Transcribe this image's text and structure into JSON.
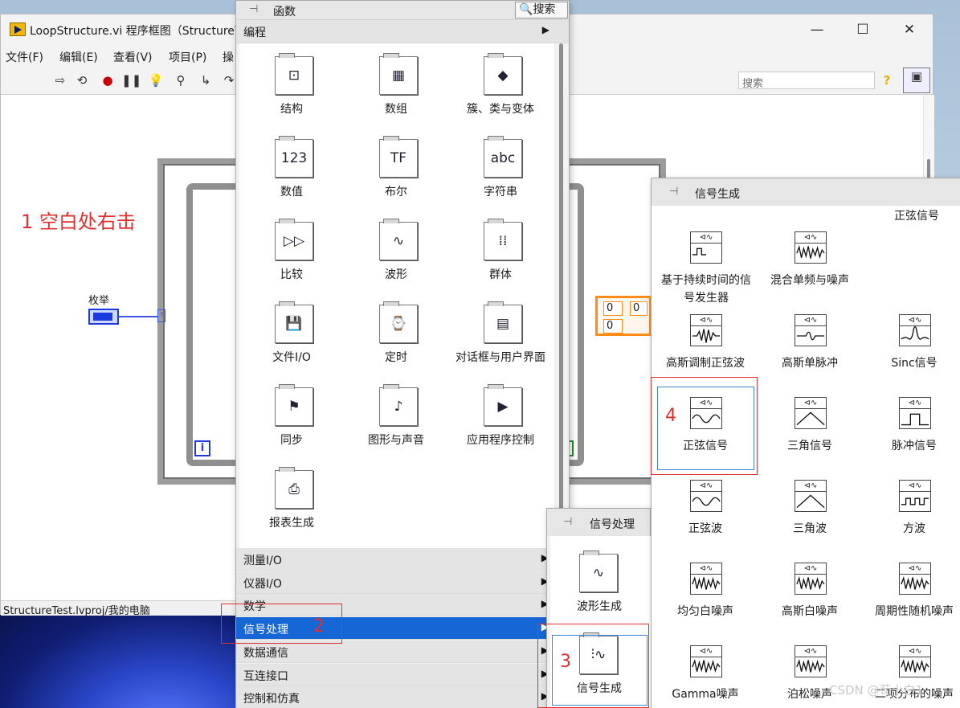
{
  "window": {
    "title": "LoopStructure.vi 程序框图（StructureTe",
    "minimize": "—",
    "maximize": "☐",
    "close": "✕"
  },
  "menu": [
    "文件(F)",
    "编辑(E)",
    "查看(V)",
    "项目(P)",
    "操"
  ],
  "toolbar": {
    "search_placeholder": "搜索",
    "tools": [
      "run-arrow-icon",
      "run-continuous-icon",
      "abort-icon",
      "pause-icon",
      "highlight-icon",
      "probe-icon",
      "step-into-icon",
      "step-over-icon"
    ]
  },
  "status": "StructureTest.lvproj/我的电脑",
  "diagram": {
    "annotation": "1 空白处右击",
    "enum_label": "枚举",
    "iteration": "i",
    "terminal": "?",
    "cluster_values": [
      "0",
      "0",
      "0"
    ]
  },
  "functions_palette": {
    "title": "函数",
    "search": "搜索",
    "section": "编程",
    "items": [
      {
        "label": "结构",
        "icon": "structure-icon",
        "glyph": "⊡"
      },
      {
        "label": "数组",
        "icon": "array-icon",
        "glyph": "▦"
      },
      {
        "label": "簇、类与变体",
        "icon": "cluster-class-icon",
        "glyph": "◆"
      },
      {
        "label": "数值",
        "icon": "numeric-icon",
        "glyph": "123"
      },
      {
        "label": "布尔",
        "icon": "boolean-icon",
        "glyph": "TF"
      },
      {
        "label": "字符串",
        "icon": "string-icon",
        "glyph": "abc"
      },
      {
        "label": "比较",
        "icon": "compare-icon",
        "glyph": "▷▷"
      },
      {
        "label": "波形",
        "icon": "waveform-icon",
        "glyph": "∿"
      },
      {
        "label": "群体",
        "icon": "synchronization-group-icon",
        "glyph": "⁞⁞"
      },
      {
        "label": "文件I/O",
        "icon": "file-io-icon",
        "glyph": "💾"
      },
      {
        "label": "定时",
        "icon": "timing-icon",
        "glyph": "⌚"
      },
      {
        "label": "对话框与用户界面",
        "icon": "dialog-ui-icon",
        "glyph": "▤"
      },
      {
        "label": "同步",
        "icon": "synchronization-icon",
        "glyph": "⚑"
      },
      {
        "label": "图形与声音",
        "icon": "graphics-sound-icon",
        "glyph": "♪"
      },
      {
        "label": "应用程序控制",
        "icon": "app-control-icon",
        "glyph": "▶"
      },
      {
        "label": "报表生成",
        "icon": "report-icon",
        "glyph": "⎙"
      }
    ],
    "categories": [
      {
        "label": "测量I/O",
        "selected": false
      },
      {
        "label": "仪器I/O",
        "selected": false
      },
      {
        "label": "数学",
        "selected": false
      },
      {
        "label": "信号处理",
        "selected": true
      },
      {
        "label": "数据通信",
        "selected": false
      },
      {
        "label": "互连接口",
        "selected": false
      },
      {
        "label": "控制和仿真",
        "selected": false
      }
    ]
  },
  "signal_processing_palette": {
    "title": "信号处理",
    "items": [
      {
        "label": "波形生成",
        "icon": "waveform-generation-icon"
      },
      {
        "label": "信号生成",
        "icon": "signal-generation-icon"
      }
    ]
  },
  "signal_generation_palette": {
    "title": "信号生成",
    "tooltip": "正弦信号",
    "items": [
      {
        "label": "基于持续时间的信号发生器",
        "icon": "duration-signal-generator-icon",
        "wave": "square-small"
      },
      {
        "label": "混合单频与噪声",
        "icon": "mixed-tone-noise-icon",
        "wave": "noise"
      },
      {
        "label": "高斯调制正弦波",
        "icon": "gaussian-modulated-sine-icon",
        "wave": "gauss-sine"
      },
      {
        "label": "高斯单脉冲",
        "icon": "gaussian-monopulse-icon",
        "wave": "monopulse"
      },
      {
        "label": "Sinc信号",
        "icon": "sinc-signal-icon",
        "wave": "sinc"
      },
      {
        "label": "正弦信号",
        "icon": "sine-signal-icon",
        "wave": "sine"
      },
      {
        "label": "三角信号",
        "icon": "triangle-signal-icon",
        "wave": "triangle"
      },
      {
        "label": "脉冲信号",
        "icon": "pulse-signal-icon",
        "wave": "pulse"
      },
      {
        "label": "正弦波",
        "icon": "sine-wave-icon",
        "wave": "sine"
      },
      {
        "label": "三角波",
        "icon": "triangle-wave-icon",
        "wave": "triangle"
      },
      {
        "label": "方波",
        "icon": "square-wave-icon",
        "wave": "square"
      },
      {
        "label": "均匀白噪声",
        "icon": "uniform-white-noise-icon",
        "wave": "noise"
      },
      {
        "label": "高斯白噪声",
        "icon": "gaussian-white-noise-icon",
        "wave": "noise"
      },
      {
        "label": "周期性随机噪声",
        "icon": "periodic-random-noise-icon",
        "wave": "noise"
      },
      {
        "label": "Gamma噪声",
        "icon": "gamma-noise-icon",
        "wave": "noise"
      },
      {
        "label": "泊松噪声",
        "icon": "poisson-noise-icon",
        "wave": "noise"
      },
      {
        "label": "二项分布的噪声",
        "icon": "binomial-noise-icon",
        "wave": "noise"
      }
    ]
  },
  "annotations": {
    "step2": "2",
    "step3": "3",
    "step4": "4"
  },
  "watermark": "CSDN @苟小白1"
}
